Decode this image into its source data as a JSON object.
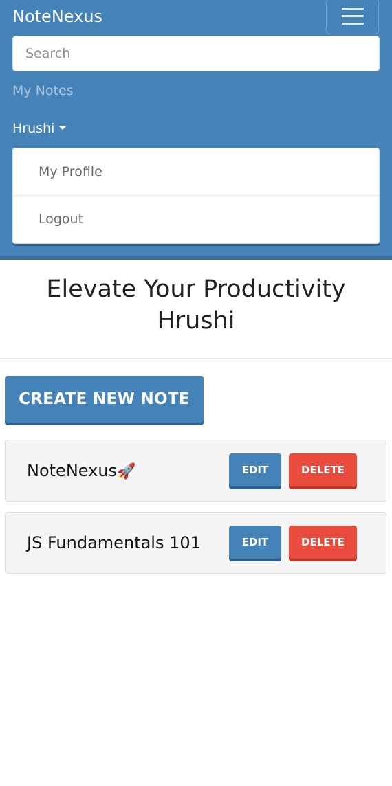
{
  "navbar": {
    "brand": "NoteNexus",
    "menu_icon": "hamburger-menu-icon",
    "search_placeholder": "Search",
    "search_value": "",
    "my_notes_link": "My Notes",
    "user_name": "Hrushi",
    "dropdown": {
      "items": [
        {
          "label": "My Profile"
        },
        {
          "label": "Logout"
        }
      ]
    }
  },
  "main": {
    "heading_line1": "Elevate Your Productivity",
    "heading_line2": "Hrushi",
    "create_button": "CREATE NEW NOTE",
    "notes": [
      {
        "title": "NoteNexus",
        "emoji": "🚀",
        "edit_label": "EDIT",
        "delete_label": "DELETE"
      },
      {
        "title": "JS Fundamentals 101",
        "emoji": "",
        "edit_label": "EDIT",
        "delete_label": "DELETE"
      }
    ]
  },
  "colors": {
    "primary": "#4582b8",
    "danger": "#e94b3c",
    "card_bg": "#f5f5f5"
  }
}
